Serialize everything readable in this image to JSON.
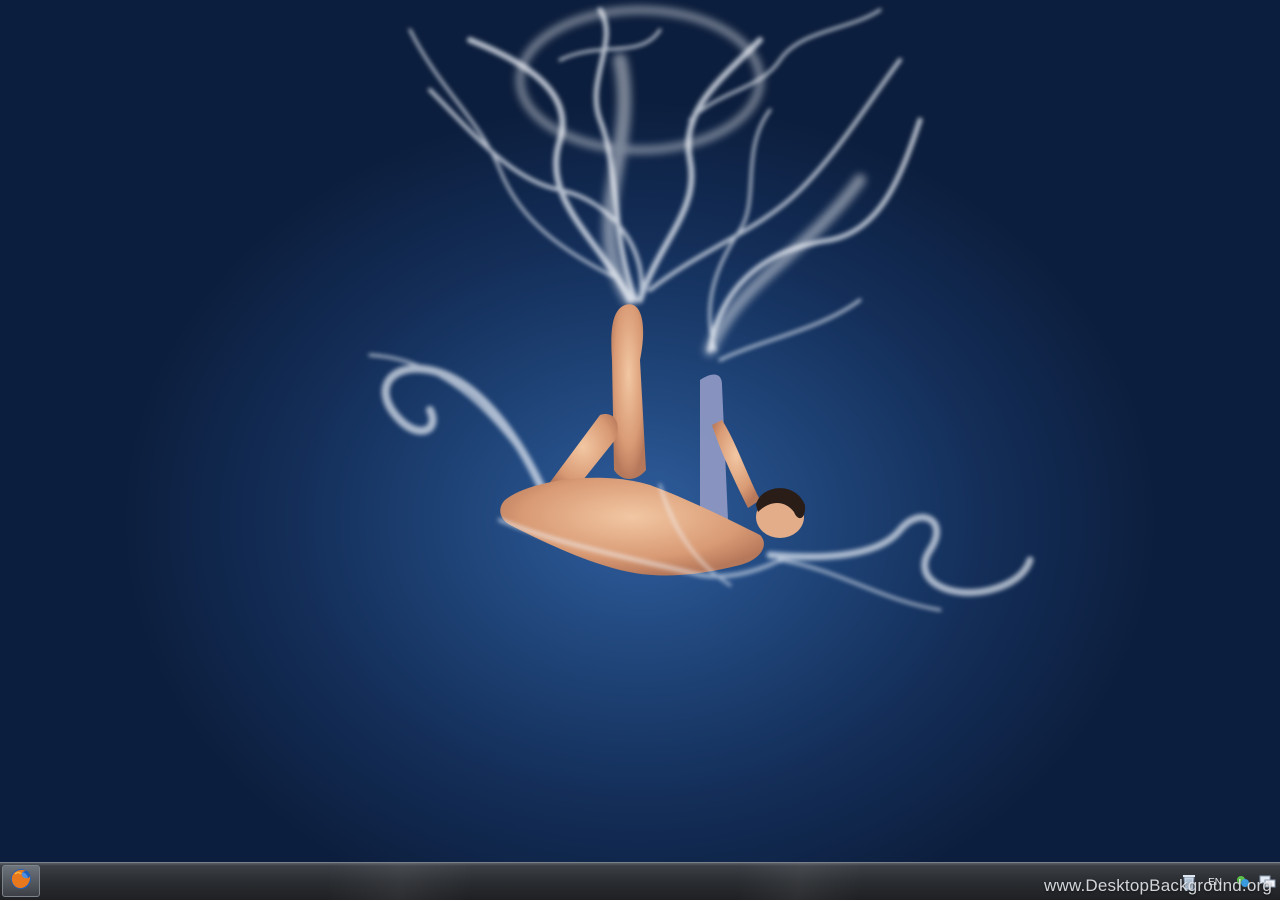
{
  "desktop": {
    "wallpaper": {
      "subject": "smoke-aerial-dancer",
      "colors": {
        "background": "#142f5a",
        "glow": "#2f5e9e",
        "smoke": "#e8eef6"
      }
    }
  },
  "taskbar": {
    "start_icon": "firefox-icon",
    "tray": {
      "recycle_icon": "recycle-bin-icon",
      "language": "EN",
      "network_icon": "network-icon",
      "chat_icon": "messenger-icon"
    }
  },
  "watermark": {
    "text": "www.DesktopBackground.org"
  }
}
